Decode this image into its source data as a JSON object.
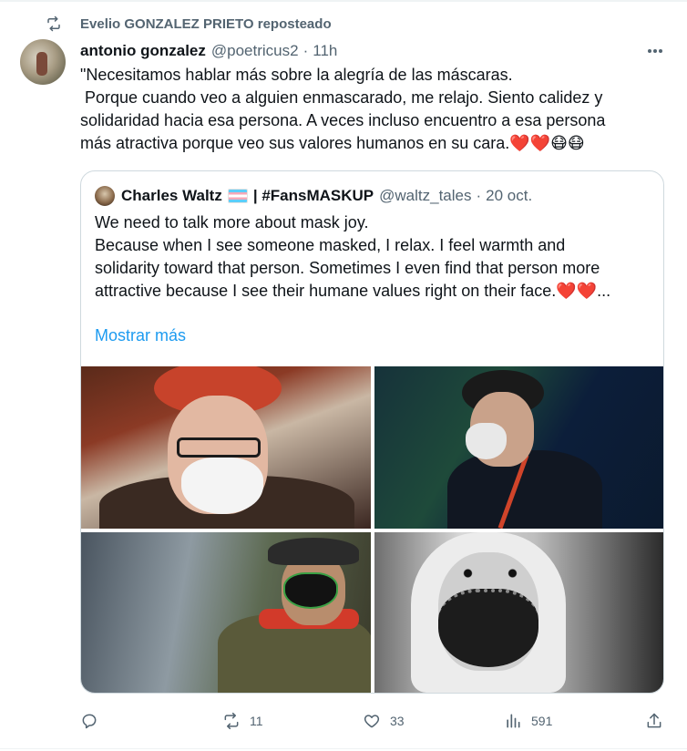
{
  "repost": {
    "label": "Evelio GONZALEZ PRIETO reposteado",
    "icon": "repost-icon"
  },
  "tweet": {
    "author_name": "antonio gonzalez",
    "handle": "@poetricus2",
    "separator": "·",
    "time": "11h",
    "text_lines": [
      "\"Necesitamos hablar más sobre la alegría de las máscaras.",
      " Porque cuando veo a alguien enmascarado, me relajo. Siento calidez y",
      "solidaridad hacia esa persona. A veces incluso encuentro a esa persona",
      "más atractiva porque veo sus valores humanos en su cara.❤️❤️😷😷"
    ],
    "more_icon": "more-icon"
  },
  "quote": {
    "author_name": "Charles Waltz",
    "flag": "transgender-flag",
    "name_suffix": "| #FansMASKUP",
    "handle": "@waltz_tales",
    "separator": "·",
    "date": "20 oct.",
    "text_lines": [
      "We need to talk more about mask joy.",
      "",
      "Because when I see someone masked, I relax. I feel warmth and",
      "solidarity toward that person. Sometimes I even find that person more",
      "attractive because I see their humane values right on their face.❤️❤️..."
    ],
    "show_more": "Mostrar más"
  },
  "actions": {
    "reply": {
      "icon": "reply-icon",
      "count": ""
    },
    "repost": {
      "icon": "repost-icon",
      "count": "11"
    },
    "like": {
      "icon": "like-icon",
      "count": "33"
    },
    "views": {
      "icon": "views-icon",
      "count": "591"
    },
    "share": {
      "icon": "share-icon"
    }
  },
  "colors": {
    "text": "#0f1419",
    "secondary": "#536471",
    "link": "#1d9bf0",
    "border": "#cfd9de"
  }
}
